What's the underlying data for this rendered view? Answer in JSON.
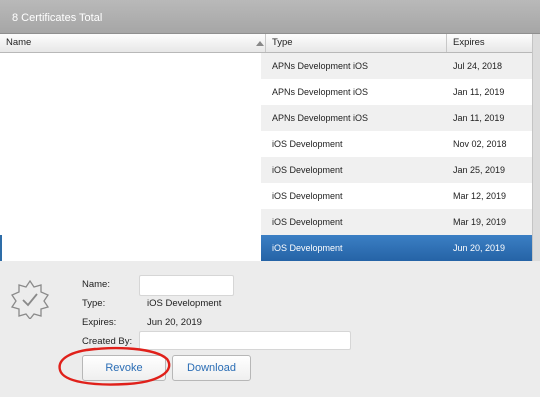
{
  "header": {
    "title": "8 Certificates Total"
  },
  "columns": {
    "name": "Name",
    "type": "Type",
    "expires": "Expires"
  },
  "rows": [
    {
      "type": "APNs Development iOS",
      "expires": "Jul 24, 2018"
    },
    {
      "type": "APNs Development iOS",
      "expires": "Jan 11, 2019"
    },
    {
      "type": "APNs Development iOS",
      "expires": "Jan 11, 2019"
    },
    {
      "type": "iOS Development",
      "expires": "Nov 02, 2018"
    },
    {
      "type": "iOS Development",
      "expires": "Jan 25, 2019"
    },
    {
      "type": "iOS Development",
      "expires": "Mar 12, 2019"
    },
    {
      "type": "iOS Development",
      "expires": "Mar 19, 2019"
    },
    {
      "type": "iOS Development",
      "expires": "Jun 20, 2019"
    }
  ],
  "selected_row": 7,
  "details": {
    "name_label": "Name:",
    "name_value": "",
    "type_label": "Type:",
    "type_value": "iOS Development",
    "expires_label": "Expires:",
    "expires_value": "Jun 20, 2019",
    "created_label": "Created By:",
    "created_value": ""
  },
  "buttons": {
    "revoke": "Revoke",
    "download": "Download"
  },
  "colors": {
    "selection": "#2e6da8",
    "link_text": "#2a6db5",
    "annotation": "#e0201a"
  },
  "icons": {
    "certificate": "certificate-badge-icon",
    "sort": "sort-ascending-icon"
  }
}
